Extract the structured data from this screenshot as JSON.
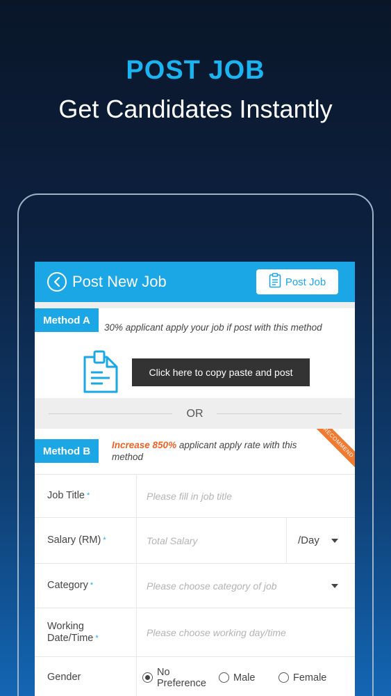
{
  "promo": {
    "title": "POST JOB",
    "subtitle": "Get Candidates Instantly"
  },
  "appbar": {
    "title": "Post New Job",
    "post_button": "Post Job"
  },
  "method_a": {
    "badge": "Method A",
    "description": "30% applicant apply your job if post with this method",
    "copy_button": "Click here to copy paste and post"
  },
  "or_label": "OR",
  "method_b": {
    "badge": "Method B",
    "highlight": "Increase 850%",
    "description": " applicant apply rate with this method",
    "ribbon": "RECOMMEND"
  },
  "form": {
    "job_title": {
      "label": "Job Title",
      "placeholder": "Please fill in job title"
    },
    "salary": {
      "label": "Salary (RM)",
      "placeholder": "Total Salary",
      "unit": "/Day"
    },
    "category": {
      "label": "Category",
      "placeholder": "Please choose category of job"
    },
    "working": {
      "label_line1": "Working",
      "label_line2": "Date/Time",
      "placeholder": "Please choose working day/time"
    },
    "gender": {
      "label": "Gender",
      "options": [
        "No Preference",
        "Male",
        "Female"
      ],
      "selected": "No Preference"
    },
    "required_mark": "*"
  },
  "colors": {
    "accent": "#1ba7e6",
    "highlight": "#ec6224",
    "dark_button": "#333333"
  }
}
